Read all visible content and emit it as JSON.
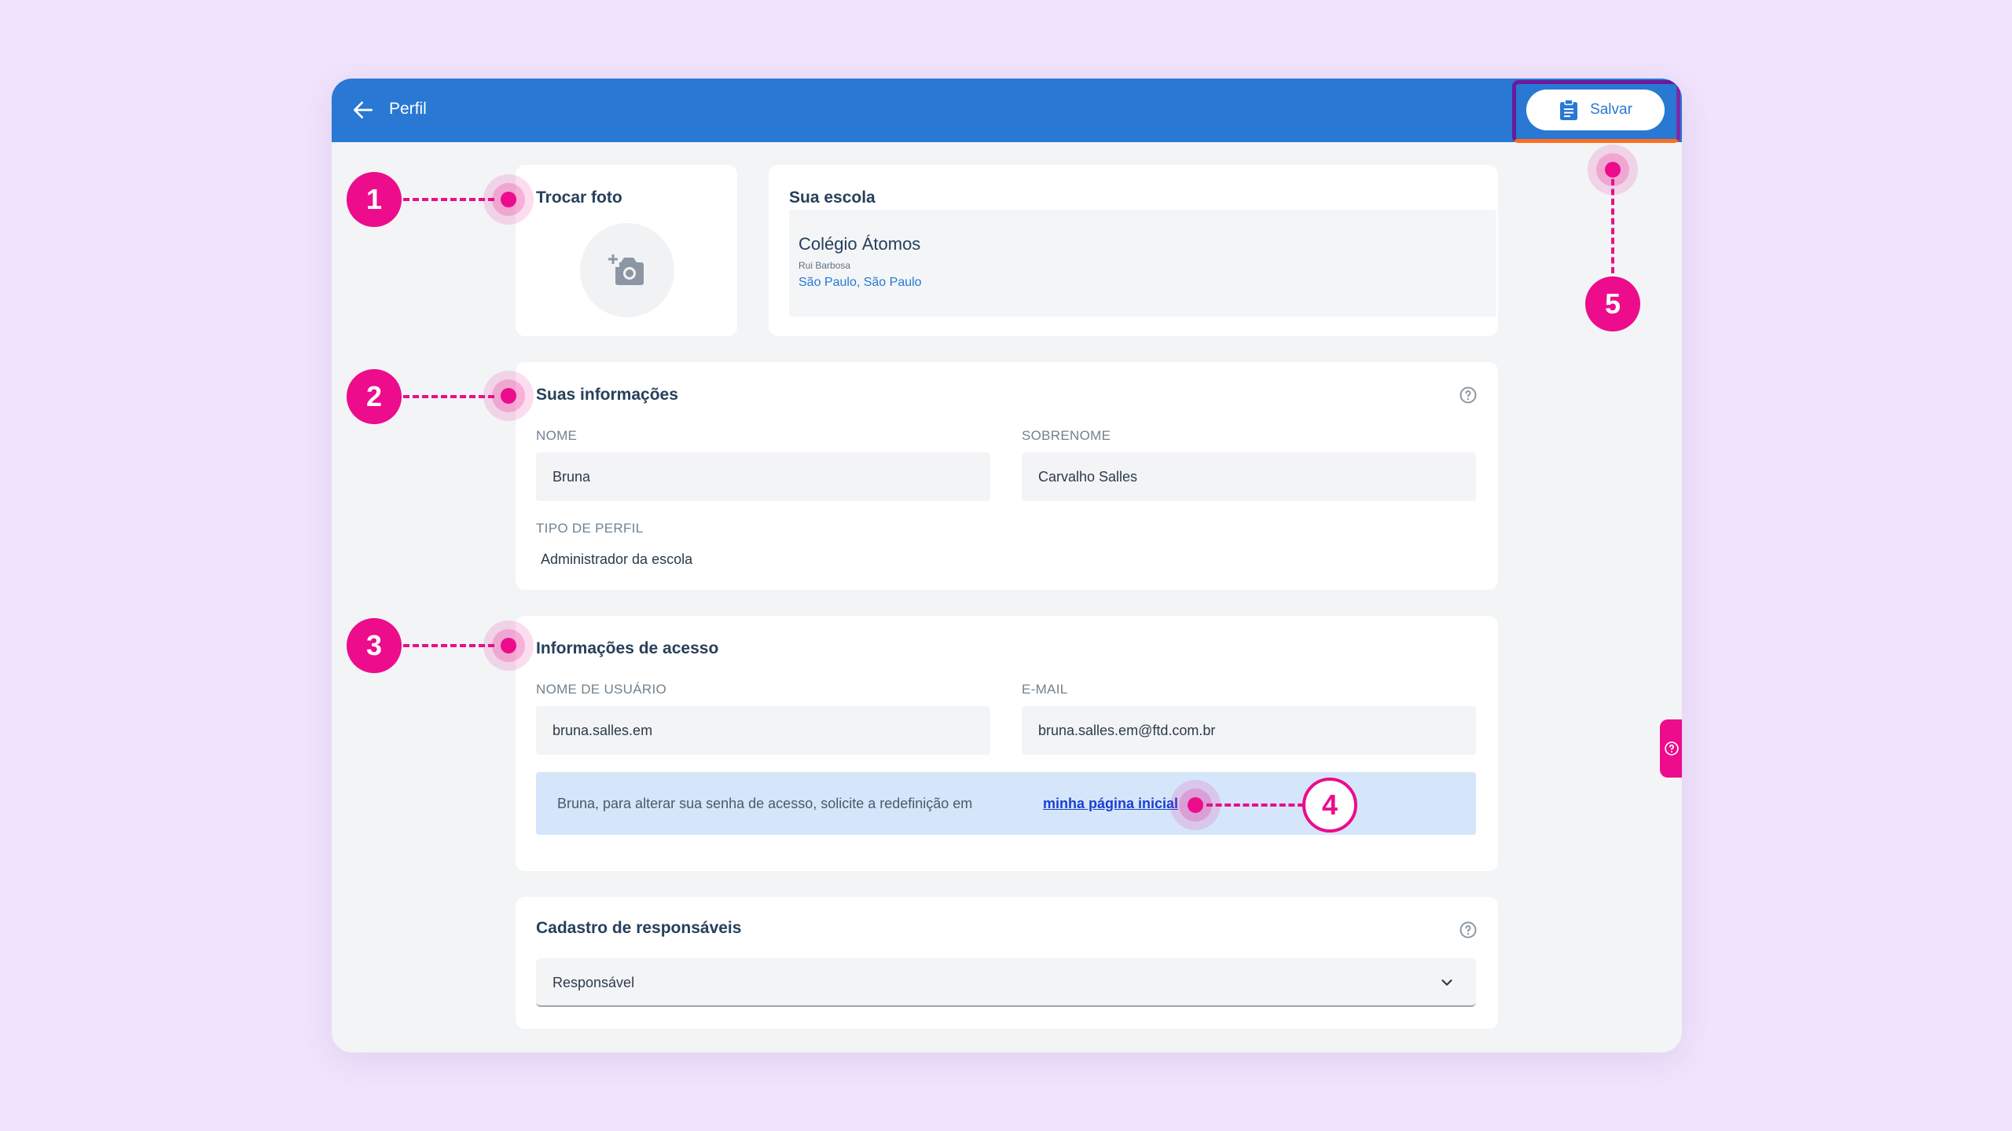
{
  "colors": {
    "background": "#f0e3fc",
    "header": "#2878d4",
    "accent": "#ec0c8c",
    "link": "#1a3fd0",
    "banner": "#d5e6fb"
  },
  "header": {
    "back_icon": "arrow-left-icon",
    "title": "Perfil",
    "save_icon": "clipboard-icon",
    "save_label": "Salvar"
  },
  "photo": {
    "title": "Trocar foto",
    "icon": "add-photo-camera-icon"
  },
  "school": {
    "title": "Sua escola",
    "name": "Colégio Átomos",
    "street": "Rui Barbosa",
    "city": "São Paulo, São Paulo"
  },
  "personal": {
    "title": "Suas informações",
    "help_icon": "help-circle-icon",
    "first_name_label": "NOME",
    "first_name": "Bruna",
    "last_name_label": "SOBRENOME",
    "last_name": "Carvalho Salles",
    "profile_type_label": "TIPO DE PERFIL",
    "profile_type": "Administrador da escola"
  },
  "access": {
    "title": "Informações de acesso",
    "username_label": "NOME DE USUÁRIO",
    "username": "bruna.salles.em",
    "email_label": "E-MAIL",
    "email": "bruna.salles.em@ftd.com.br",
    "notice": "Bruna, para alterar sua senha de acesso, solicite a redefinição em",
    "notice_link": "minha página inicial"
  },
  "guardians": {
    "title": "Cadastro de responsáveis",
    "help_icon": "help-circle-icon",
    "select_value": "Responsável",
    "chevron_icon": "chevron-down-icon"
  },
  "side_help_icon": "help-circle-icon",
  "annotations": {
    "badge_1": "1",
    "badge_2": "2",
    "badge_3": "3",
    "badge_4": "4",
    "badge_5": "5"
  }
}
